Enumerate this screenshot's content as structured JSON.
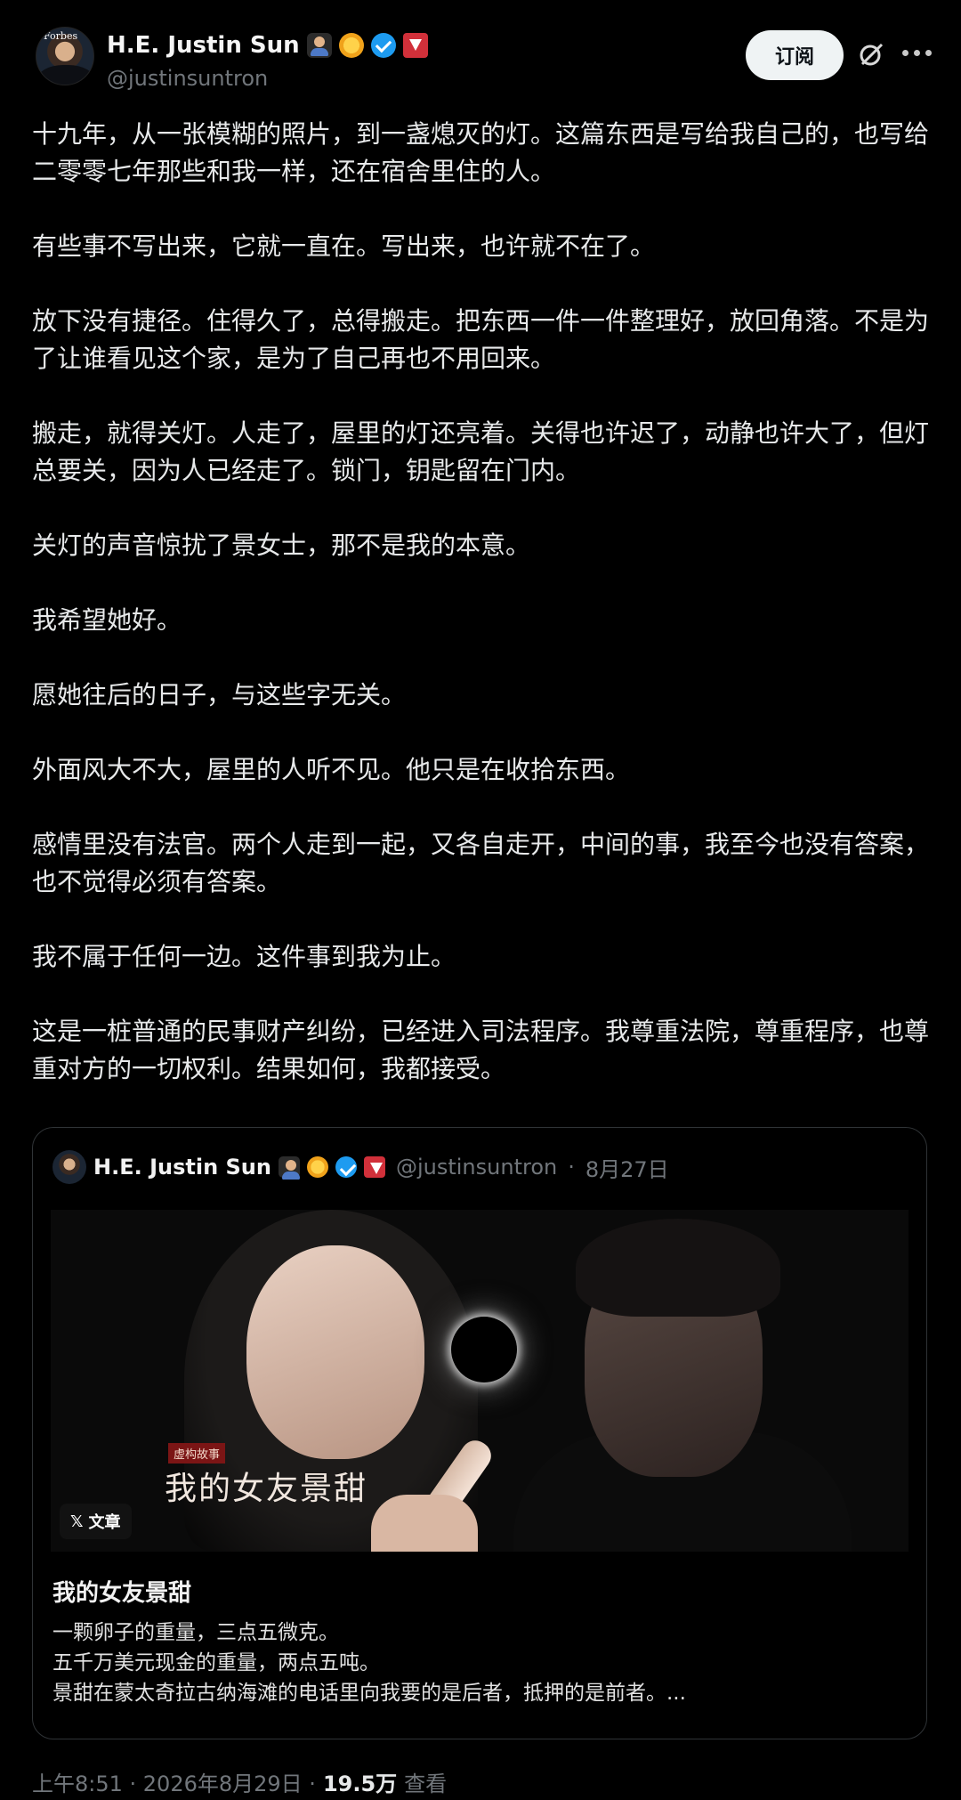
{
  "author": {
    "display_name": "H.E. Justin Sun",
    "handle": "@justinsuntron",
    "avatar_text": "Forbes",
    "badges": [
      "person-emoji-badge",
      "sun-emoji-badge",
      "verified-badge",
      "tron-badge"
    ]
  },
  "actions": {
    "subscribe_label": "订阅",
    "grok_icon": "grok-icon",
    "more_icon": "more-icon"
  },
  "post": {
    "paragraphs": [
      "十九年，从一张模糊的照片，到一盏熄灭的灯。这篇东西是写给我自己的，也写给二零零七年那些和我一样，还在宿舍里住的人。",
      "有些事不写出来，它就一直在。写出来，也许就不在了。",
      "放下没有捷径。住得久了，总得搬走。把东西一件一件整理好，放回角落。不是为了让谁看见这个家，是为了自己再也不用回来。",
      "搬走，就得关灯。人走了，屋里的灯还亮着。关得也许迟了，动静也许大了，但灯总要关，因为人已经走了。锁门，钥匙留在门内。",
      "关灯的声音惊扰了景女士，那不是我的本意。",
      "我希望她好。",
      "愿她往后的日子，与这些字无关。",
      "外面风大不大，屋里的人听不见。他只是在收拾东西。",
      "感情里没有法官。两个人走到一起，又各自走开，中间的事，我至今也没有答案，也不觉得必须有答案。",
      "我不属于任何一边。这件事到我为止。",
      "这是一桩普通的民事财产纠纷，已经进入司法程序。我尊重法院，尊重程序，也尊重对方的一切权利。结果如何，我都接受。"
    ]
  },
  "quote": {
    "display_name": "H.E. Justin Sun",
    "handle": "@justinsuntron",
    "separator": "·",
    "date": "8月27日",
    "image": {
      "tag": "虚构故事",
      "cover_title": "我的女友景甜",
      "chip_logo": "𝕏",
      "chip_label": "文章"
    },
    "article_title": "我的女友景甜",
    "excerpt": [
      "一颗卵子的重量，三点五微克。",
      "五千万美元现金的重量，两点五吨。",
      "景甜在蒙太奇拉古纳海滩的电话里向我要的是后者，抵押的是前者。..."
    ]
  },
  "meta": {
    "time": "上午8:51 · 2026年8月29日 ·",
    "views_count": "19.5万",
    "views_label": "查看"
  },
  "colors": {
    "background": "#000000",
    "text": "#e7e9ea",
    "muted": "#71767b",
    "verified": "#1d9bf0",
    "tron": "#d1303a"
  }
}
